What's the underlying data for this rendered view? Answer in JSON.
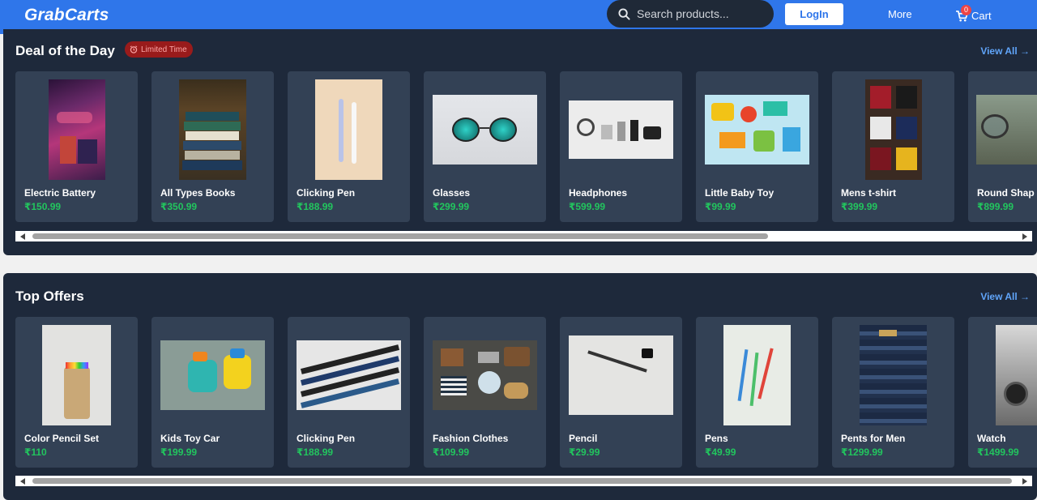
{
  "header": {
    "logo": "GrabCarts",
    "search_placeholder": "Search products...",
    "login_label": "LogIn",
    "more_label": "More",
    "cart_label": "Cart",
    "cart_count": "0"
  },
  "deal": {
    "title": "Deal of the Day",
    "badge": "Limited Time",
    "view_all": "View All →",
    "products": [
      {
        "name": "Electric Battery",
        "price": "₹150.99"
      },
      {
        "name": "All Types Books",
        "price": "₹350.99"
      },
      {
        "name": "Clicking Pen",
        "price": "₹188.99"
      },
      {
        "name": "Glasses",
        "price": "₹299.99"
      },
      {
        "name": "Headphones",
        "price": "₹599.99"
      },
      {
        "name": "Little Baby Toy",
        "price": "₹99.99"
      },
      {
        "name": "Mens t-shirt",
        "price": "₹399.99"
      },
      {
        "name": "Round Shap",
        "price": "₹899.99"
      }
    ]
  },
  "offers": {
    "title": "Top Offers",
    "view_all": "View All →",
    "products": [
      {
        "name": "Color Pencil Set",
        "price": "₹110"
      },
      {
        "name": "Kids Toy Car",
        "price": "₹199.99"
      },
      {
        "name": "Clicking Pen",
        "price": "₹188.99"
      },
      {
        "name": "Fashion Clothes",
        "price": "₹109.99"
      },
      {
        "name": "Pencil",
        "price": "₹29.99"
      },
      {
        "name": "Pens",
        "price": "₹49.99"
      },
      {
        "name": "Pents for Men",
        "price": "₹1299.99"
      },
      {
        "name": "Watch",
        "price": "₹1499.99"
      }
    ]
  },
  "colors": {
    "header_bg": "#2f76ea",
    "section_bg": "#1e293b",
    "card_bg": "#334155",
    "price_green": "#22c55e",
    "link_blue": "#60a5fa",
    "badge_red": "#991b1b"
  }
}
